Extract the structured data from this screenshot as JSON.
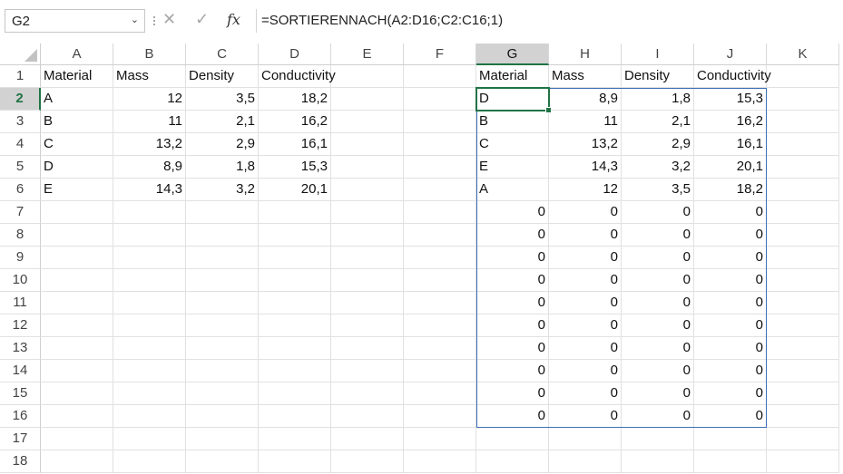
{
  "formula_bar": {
    "name_box": "G2",
    "cancel_glyph": "✕",
    "enter_glyph": "✓",
    "fx_label": "fx",
    "formula": "=SORTIERENNACH(A2:D16;C2:C16;1)"
  },
  "columns": [
    "A",
    "B",
    "C",
    "D",
    "E",
    "F",
    "G",
    "H",
    "I",
    "J",
    "K"
  ],
  "rows": [
    "1",
    "2",
    "3",
    "4",
    "5",
    "6",
    "7",
    "8",
    "9",
    "10",
    "11",
    "12",
    "13",
    "14",
    "15",
    "16",
    "17",
    "18"
  ],
  "selected_column": "G",
  "selected_row": "2",
  "source_table": {
    "headers": [
      "Material",
      "Mass",
      "Density",
      "Conductivity"
    ],
    "rows": [
      [
        "A",
        "12",
        "3,5",
        "18,2"
      ],
      [
        "B",
        "11",
        "2,1",
        "16,2"
      ],
      [
        "C",
        "13,2",
        "2,9",
        "16,1"
      ],
      [
        "D",
        "8,9",
        "1,8",
        "15,3"
      ],
      [
        "E",
        "14,3",
        "3,2",
        "20,1"
      ]
    ]
  },
  "sorted_table": {
    "headers": [
      "Material",
      "Mass",
      "Density",
      "Conductivity"
    ],
    "rows": [
      [
        "D",
        "8,9",
        "1,8",
        "15,3"
      ],
      [
        "B",
        "11",
        "2,1",
        "16,2"
      ],
      [
        "C",
        "13,2",
        "2,9",
        "16,1"
      ],
      [
        "E",
        "14,3",
        "3,2",
        "20,1"
      ],
      [
        "A",
        "12",
        "3,5",
        "18,2"
      ],
      [
        "0",
        "0",
        "0",
        "0"
      ],
      [
        "0",
        "0",
        "0",
        "0"
      ],
      [
        "0",
        "0",
        "0",
        "0"
      ],
      [
        "0",
        "0",
        "0",
        "0"
      ],
      [
        "0",
        "0",
        "0",
        "0"
      ],
      [
        "0",
        "0",
        "0",
        "0"
      ],
      [
        "0",
        "0",
        "0",
        "0"
      ],
      [
        "0",
        "0",
        "0",
        "0"
      ],
      [
        "0",
        "0",
        "0",
        "0"
      ],
      [
        "0",
        "0",
        "0",
        "0"
      ]
    ]
  }
}
